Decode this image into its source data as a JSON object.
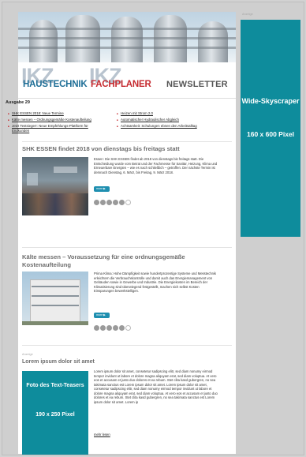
{
  "header": {
    "logo_mark": "IKZ",
    "brand_haustechnik": "HAUSTECHNIK",
    "brand_fachplaner": "FACHPLANER",
    "title": "NEWSLETTER"
  },
  "issue": "Ausgabe 29",
  "toc": {
    "left": [
      "SHK ESSEN 2018: Neue Termine",
      "Kälte messen – Ordnungsgemäße Kostenaufteilung",
      "Jetzt Testsieger!: Neue Empfehlungs-Plattform für Endkunden"
    ],
    "right": [
      "Heizen mit Strom 2.0",
      "Automatischer Hydraulischer Abgleich",
      "Achtsamkeit: Schulungen ebnen den Arbeitsalltag"
    ]
  },
  "article1": {
    "title": "SHK ESSEN findet 2018 von dienstags bis freitags statt",
    "body": "Essen: Die SHK ESSEN findet ab 2018 von dienstags bis freitags statt. Die Entscheidung wurde vom Beirat und der Fachmesse für Sanitär, Heizung, Klima und Erneuerbare Energien – wie es nach schließlich – getroffen. Der nächste Termin ist demnach Dienstag, 6. März, bis Freitag, 9. März 2018.",
    "more": "more ▶"
  },
  "article2": {
    "title": "Kälte messen – Voraussetzung für eine ordnungsgemäße Kostenaufteilung",
    "body": "Prima Klima: Hohe Dämpfigkeit sowie hundertprozentige Systeme und Messtechnik erleichtern die Verbrauchskontrolle und damit auch das Energiemanagement von Gebäuden sowie in Gewerbe und Industrie. Die Energiekosten im Bereich der Klimatisierung sind überwiegend festgestellt, machen sich selbst Kosten Einsparungen bewerkstelligen.",
    "more": "more ▶"
  },
  "teaser": {
    "label": "Anzeige",
    "title": "Lorem ipsum dolor sit amet",
    "body": "Lorem ipsum dolor sit amet, consetetur sadipscing elitr, sed diam nonumy eirmod tempor invidunt ut labore et dolore magna aliquyam erat, sed diam voluptua. At vero eos et accusam et justo duo dolores et ea rebum. Stet clita kasd gubergren, no sea takimata sanctus est Lorem ipsum dolor sit amet. Lorem ipsum dolor sit amet, consetetur sadipscing elitr, sed diam nonumy eirmod tempor invidunt ut labore et dolore magna aliquyam erat, sed diam voluptua. At vero eos et accusam et justo duo dolores et ea rebum. Stet clita kasd gubergren, no sea takimata sanctus est Lorem ipsum dolor sit amet. Lorem ip",
    "link": "mehr lesen",
    "photo_title": "Foto des Text-Teasers",
    "photo_size": "190 x 250 Pixel"
  },
  "skyscraper": {
    "label": "Anzeige",
    "title": "Wide-Skyscraper",
    "size": "160 x 600 Pixel"
  },
  "colors": {
    "teal": "#0e8c9c",
    "red": "#c62b30",
    "blue": "#1e6e96"
  }
}
